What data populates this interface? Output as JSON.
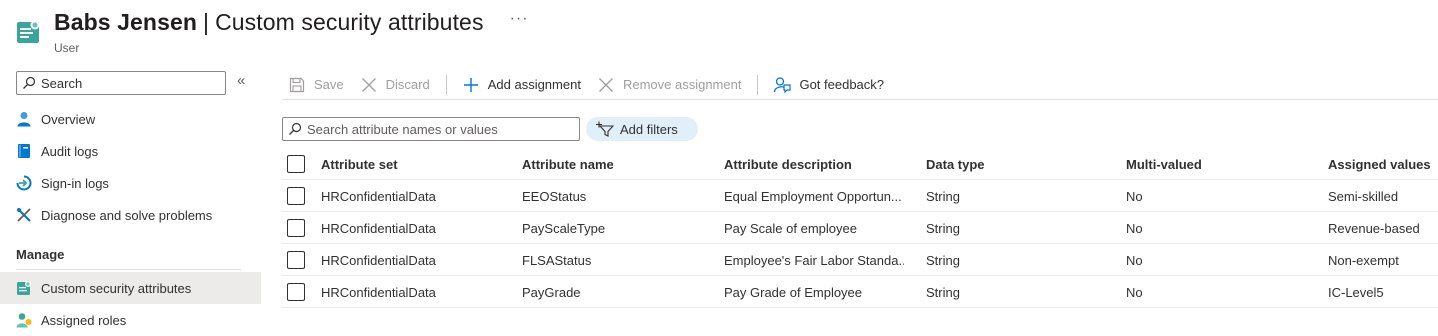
{
  "header": {
    "name": "Babs Jensen",
    "separator": "|",
    "page": "Custom security attributes",
    "subtitle": "User",
    "more": "···"
  },
  "sidebar": {
    "search_placeholder": "Search",
    "collapse": "«",
    "items": [
      {
        "label": "Overview",
        "icon": "person-icon"
      },
      {
        "label": "Audit logs",
        "icon": "audit-logs-icon"
      },
      {
        "label": "Sign-in logs",
        "icon": "sign-in-logs-icon"
      },
      {
        "label": "Diagnose and solve problems",
        "icon": "wrench-icon"
      }
    ],
    "section_label": "Manage",
    "manage_items": [
      {
        "label": "Custom security attributes",
        "icon": "custom-security-attributes-icon",
        "active": true
      },
      {
        "label": "Assigned roles",
        "icon": "assigned-roles-icon"
      }
    ]
  },
  "toolbar": {
    "save": "Save",
    "discard": "Discard",
    "add_assignment": "Add assignment",
    "remove_assignment": "Remove assignment",
    "feedback": "Got feedback?"
  },
  "filters": {
    "search_placeholder": "Search attribute names or values",
    "add_filters": "Add filters"
  },
  "table": {
    "columns": [
      "Attribute set",
      "Attribute name",
      "Attribute description",
      "Data type",
      "Multi-valued",
      "Assigned values"
    ],
    "rows": [
      [
        "HRConfidentialData",
        "EEOStatus",
        "Equal Employment Opportun...",
        "String",
        "No",
        "Semi-skilled"
      ],
      [
        "HRConfidentialData",
        "PayScaleType",
        "Pay Scale of employee",
        "String",
        "No",
        "Revenue-based"
      ],
      [
        "HRConfidentialData",
        "FLSAStatus",
        "Employee's Fair Labor Standa...",
        "String",
        "No",
        "Non-exempt"
      ],
      [
        "HRConfidentialData",
        "PayGrade",
        "Pay Grade of Employee",
        "String",
        "No",
        "IC-Level5"
      ]
    ]
  },
  "colors": {
    "accent": "#0078d4",
    "teal": "#3aa59a",
    "active_bg": "#edebe9",
    "pill_bg": "#e1eff9"
  }
}
